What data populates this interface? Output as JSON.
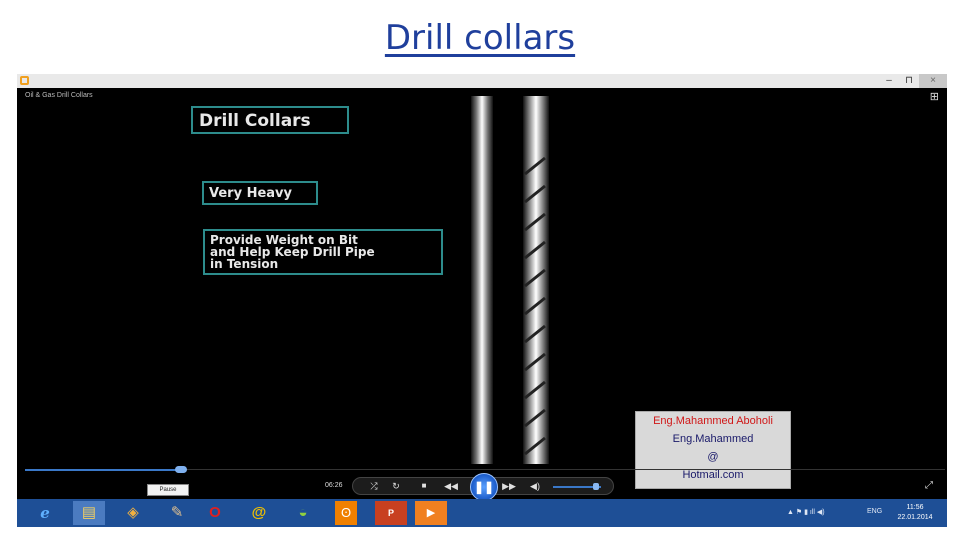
{
  "slide": {
    "title": "Drill collars"
  },
  "window": {
    "media_title": "Oil & Gas Drill Collars",
    "minimize": "–",
    "maximize": "⊓",
    "close": "×",
    "switch_view": "⊞"
  },
  "video": {
    "heading": "Drill Collars",
    "point_1": "Very Heavy",
    "point_2_lines": [
      "Provide Weight on Bit",
      "and Help Keep Drill Pipe",
      "in Tension"
    ]
  },
  "credits": {
    "line_1": "Eng.Mahammed Aboholi",
    "line_2": "Eng.Mahammed",
    "line_3": "@",
    "line_4": "Hotmail.com"
  },
  "playback": {
    "tooltip": "Pause",
    "elapsed_time": "06:26",
    "progress_fraction": 0.17,
    "volume_fraction": 0.9,
    "controls": {
      "shuffle": "⤮",
      "repeat": "↻",
      "stop": "■",
      "previous": "◀◀",
      "play_pause": "❚❚",
      "next": "▶▶",
      "mute": "◀)"
    },
    "fullscreen": "⤢"
  },
  "taskbar": {
    "apps": [
      {
        "name": "internet-explorer",
        "glyph": "e"
      },
      {
        "name": "file-explorer",
        "glyph": "▤"
      },
      {
        "name": "app-3",
        "glyph": "◈"
      },
      {
        "name": "app-4",
        "glyph": "✎"
      },
      {
        "name": "opera",
        "glyph": "O"
      },
      {
        "name": "mail",
        "glyph": "@"
      },
      {
        "name": "app-7",
        "glyph": "◒"
      },
      {
        "name": "odnoklassniki",
        "glyph": "ʘ"
      },
      {
        "name": "powerpoint",
        "glyph": "P"
      },
      {
        "name": "media-player",
        "glyph": "▶"
      }
    ],
    "tray_icons": "▲ ⚑ ▮ ıll ◀)",
    "language": "ENG",
    "time": "11:56",
    "date": "22.01.2014"
  }
}
